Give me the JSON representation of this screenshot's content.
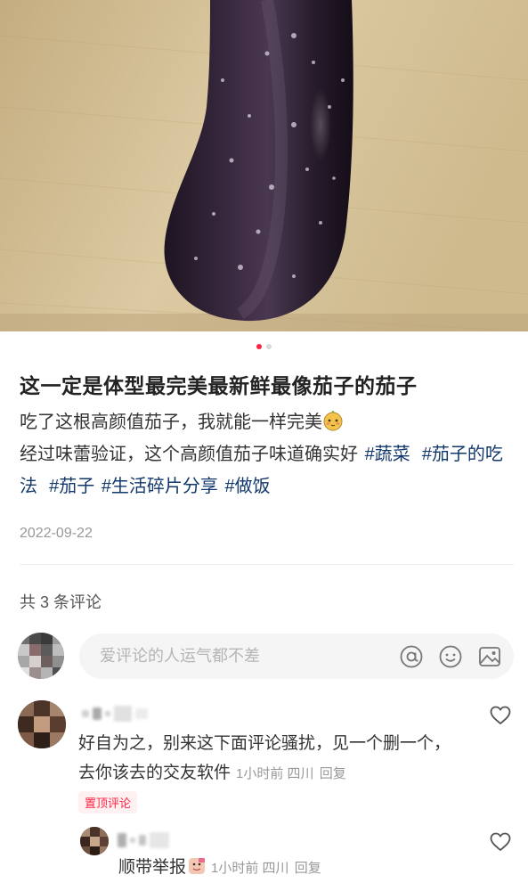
{
  "post": {
    "title": "这一定是体型最完美最新鲜最像茄子的茄子",
    "line1": "吃了这根高颜值茄子，我就能一样完美",
    "line2": "经过味蕾验证，这个高颜值茄子味道确实好",
    "tags": [
      "#蔬菜",
      "#茄子的吃法",
      "#茄子",
      "#生活碎片分享",
      "#做饭"
    ],
    "date": "2022-09-22"
  },
  "carousel": {
    "total": 2,
    "active": 1
  },
  "comments_header": "共 3 条评论",
  "comment_input": {
    "placeholder": "爱评论的人运气都不差"
  },
  "comments": [
    {
      "text": "好自为之，别来这下面评论骚扰，见一个删一个，去你该去的交友软件",
      "time": "1小时前",
      "location": "四川",
      "reply_label": "回复",
      "badge": "置顶评论"
    },
    {
      "text": "顺带举报",
      "time": "1小时前",
      "location": "四川",
      "reply_label": "回复"
    }
  ],
  "icons": [
    "mention-icon",
    "emoji-icon",
    "image-icon",
    "heart-icon"
  ],
  "colors": {
    "accent": "#ff2442",
    "tag": "#13386c",
    "muted": "#999999"
  }
}
